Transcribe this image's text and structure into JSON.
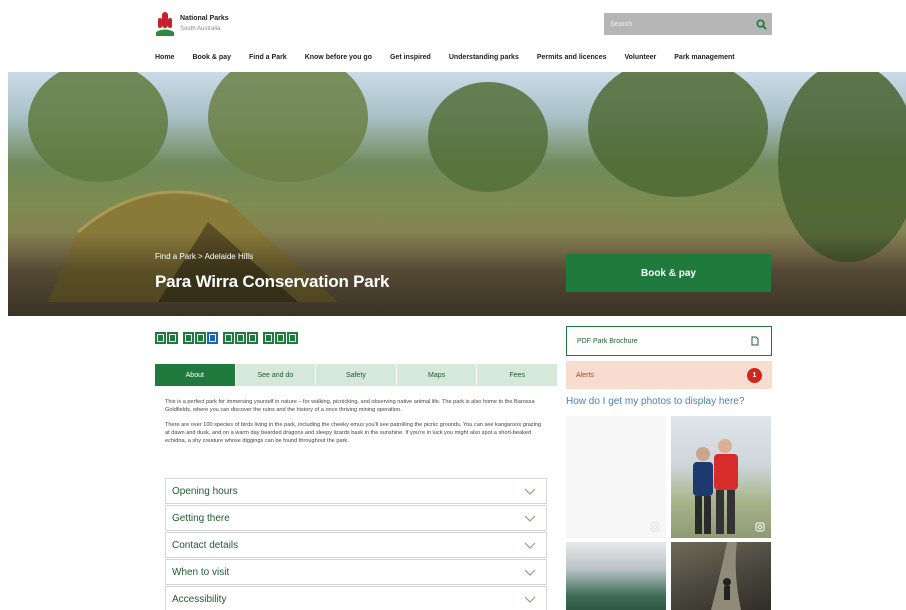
{
  "logo": {
    "line1": "National Parks",
    "line2": "South Australia"
  },
  "search": {
    "placeholder": "Search"
  },
  "nav": [
    "Home",
    "Book & pay",
    "Find a Park",
    "Know before you go",
    "Get inspired",
    "Understanding parks",
    "Permits and licences",
    "Volunteer",
    "Park management"
  ],
  "hero": {
    "breadcrumb": [
      "Find a Park",
      ">",
      "Adelaide Hills"
    ],
    "title": "Para Wirra Conservation Park",
    "book_label": "Book & pay"
  },
  "facility_icons": [
    "picnic-table-icon",
    "bbq-icon",
    "toilets-icon",
    "camping-icon",
    "accessible-icon",
    "walking-icon",
    "cycling-icon",
    "hiking-icon",
    "dog-icon",
    "information-icon",
    "playground-icon"
  ],
  "tabs": [
    "About",
    "See and do",
    "Safety",
    "Maps",
    "Fees"
  ],
  "about": {
    "p1": "This is a perfect park for immersing yourself in nature – for walking, picnicking, and observing native animal life. The park is also home to the Barossa Goldfields, where you can discover the ruins and the history of a once thriving mining operation.",
    "p2": "There are over 100 species of birds living in the park, including the cheeky emus you'll see patrolling the picnic grounds. You can see kangaroos grazing at dawn and dusk, and on a warm day bearded dragons and sleepy lizards bask in the sunshine. If you're in luck you might also spot a short-beaked echidna, a shy creature whose diggings can be found throughout the park."
  },
  "accordion": [
    "Opening hours",
    "Getting there",
    "Contact details",
    "When to visit",
    "Accessibility"
  ],
  "sidebar": {
    "pdf_label": "PDF Park Brochure",
    "alerts_label": "Alerts",
    "alerts_count": "1",
    "photos_question": "How do I get my photos to display here?"
  },
  "colors": {
    "brand_green": "#1f7a3d",
    "tab_inactive": "#d5e8da",
    "alert_bg": "#f8dcd0",
    "alert_badge": "#d0271d",
    "link_blue": "#4d7fb5"
  }
}
